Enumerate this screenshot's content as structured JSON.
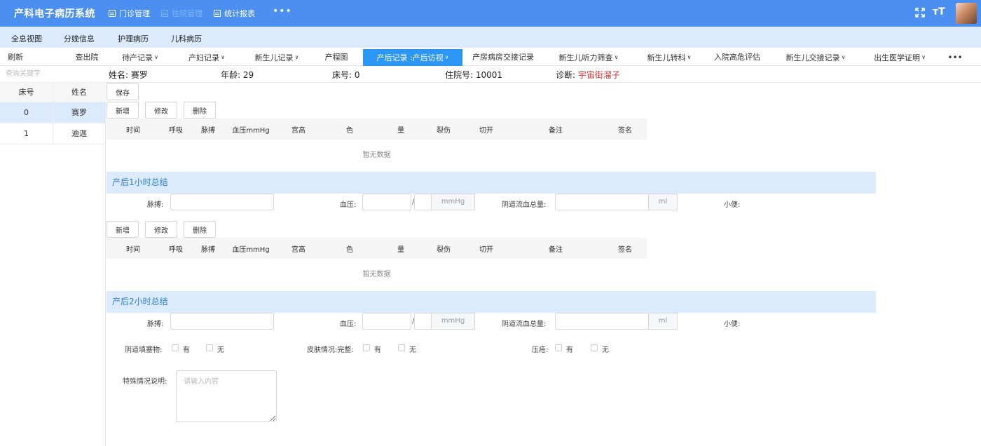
{
  "header": {
    "app_title": "产科电子病历系统",
    "nav": [
      {
        "label": "门诊管理",
        "icon": "grid-icon"
      },
      {
        "label": "住院管理",
        "icon": "grid-icon"
      },
      {
        "label": "统计报表",
        "icon": "report-icon"
      }
    ],
    "more": "•••",
    "font_label": "ᴛT"
  },
  "subnav": [
    "全息视图",
    "分娩信息",
    "护理病历",
    "儿科病历"
  ],
  "actions": {
    "refresh": "刷新",
    "discharged": "查出院"
  },
  "tabs": [
    {
      "label": "待产记录",
      "dropdown": true
    },
    {
      "label": "产妇记录",
      "dropdown": true
    },
    {
      "label": "新生儿记录",
      "dropdown": true
    },
    {
      "label": "产程图",
      "dropdown": false
    },
    {
      "label": "产后记录 :产后访视",
      "dropdown": true,
      "active": true
    },
    {
      "label": "产房病房交接记录",
      "dropdown": false
    },
    {
      "label": "新生儿听力筛查",
      "dropdown": true
    },
    {
      "label": "新生儿转科",
      "dropdown": true
    },
    {
      "label": "入院高危评估",
      "dropdown": false
    },
    {
      "label": "新生儿交接记录",
      "dropdown": true
    },
    {
      "label": "出生医学证明",
      "dropdown": true
    }
  ],
  "tabs_more": "•••",
  "sidebar": {
    "search_placeholder": "查询关键字",
    "columns": [
      "床号",
      "姓名"
    ],
    "rows": [
      {
        "bed": "0",
        "name": "赛罗"
      },
      {
        "bed": "1",
        "name": "迪迦"
      }
    ]
  },
  "patient": {
    "name_label": "姓名:",
    "name": "赛罗",
    "age_label": "年龄:",
    "age": "29",
    "bed_label": "床号:",
    "bed": "0",
    "admission_label": "住院号:",
    "admission": "10001",
    "diagnosis_label": "诊断:",
    "diagnosis": "宇宙街溜子"
  },
  "buttons": {
    "save": "保存",
    "add": "新增",
    "edit": "修改",
    "delete": "删除"
  },
  "table": {
    "columns": [
      "时间",
      "呼吸",
      "脉搏",
      "血压mmHg",
      "宫高",
      "色",
      "量",
      "裂伤",
      "切开",
      "备注",
      "签名"
    ],
    "empty_text": "暂无数据"
  },
  "sections": {
    "one_hour": "产后1小时总结",
    "two_hour": "产后2小时总结"
  },
  "summary_fields": {
    "pulse": "脉搏:",
    "bp": "血压:",
    "bp_sep": "/",
    "bp_unit": "mmHg",
    "bleeding": "阴道流血总量:",
    "bleeding_unit": "ml",
    "urine": "小便:"
  },
  "checks": {
    "vaginal_packing": "阴道填塞物:",
    "skin_intact": "皮肤情况:完整:",
    "pressure_sore": "压疮:",
    "yes": "有",
    "no": "无"
  },
  "special": {
    "label": "特殊情况说明:",
    "placeholder": "请输入内容"
  }
}
